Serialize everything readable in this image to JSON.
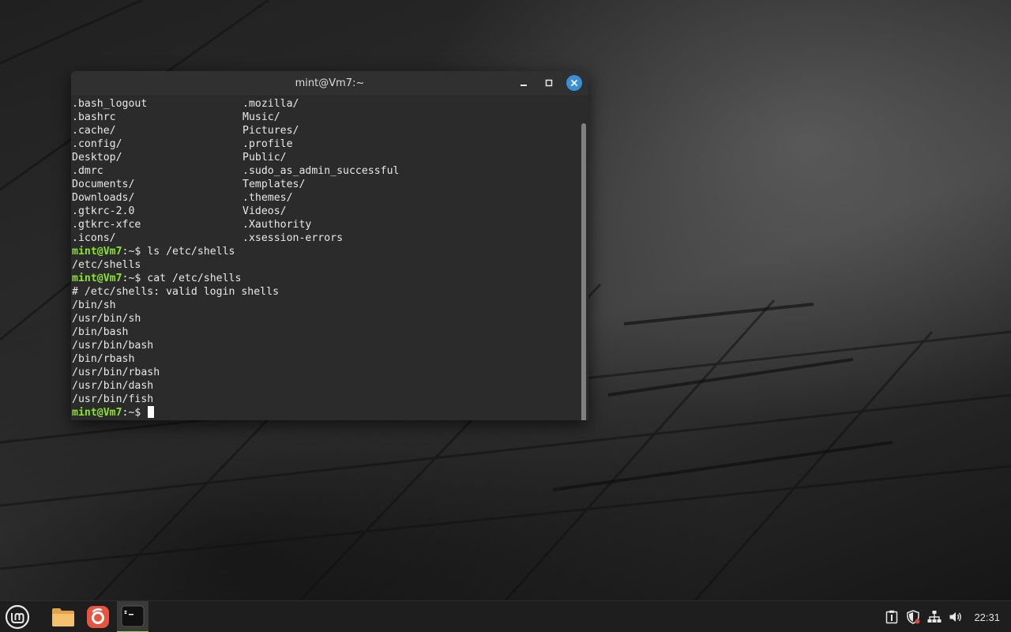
{
  "window": {
    "title": "mint@Vm7:~"
  },
  "listing": [
    {
      "left": ".bash_logout",
      "right": ".mozilla/"
    },
    {
      "left": ".bashrc",
      "right": "Music/"
    },
    {
      "left": ".cache/",
      "right": "Pictures/"
    },
    {
      "left": ".config/",
      "right": ".profile"
    },
    {
      "left": "Desktop/",
      "right": "Public/"
    },
    {
      "left": ".dmrc",
      "right": ".sudo_as_admin_successful"
    },
    {
      "left": "Documents/",
      "right": "Templates/"
    },
    {
      "left": "Downloads/",
      "right": ".themes/"
    },
    {
      "left": ".gtkrc-2.0",
      "right": "Videos/"
    },
    {
      "left": ".gtkrc-xfce",
      "right": ".Xauthority"
    },
    {
      "left": ".icons/",
      "right": ".xsession-errors"
    }
  ],
  "prompt": {
    "user_host": "mint@Vm7",
    "rest": ":~$ "
  },
  "commands": {
    "ls": "ls /etc/shells",
    "ls_output": "/etc/shells",
    "cat": "cat /etc/shells",
    "cat_output": [
      "# /etc/shells: valid login shells",
      "/bin/sh",
      "/usr/bin/sh",
      "/bin/bash",
      "/usr/bin/bash",
      "/bin/rbash",
      "/usr/bin/rbash",
      "/usr/bin/dash",
      "/usr/bin/fish"
    ]
  },
  "taskbar": {
    "icons": [
      "mint-menu-icon",
      "files-folder-icon",
      "firefox-icon",
      "terminal-icon"
    ],
    "tray_icons": [
      "notes-icon",
      "shield-icon",
      "network-icon",
      "volume-icon"
    ],
    "clock": "22:31",
    "accent": "#8ccf5b"
  },
  "colors": {
    "prompt_user": "#8ae234",
    "close_button": "#3a8fd6"
  }
}
